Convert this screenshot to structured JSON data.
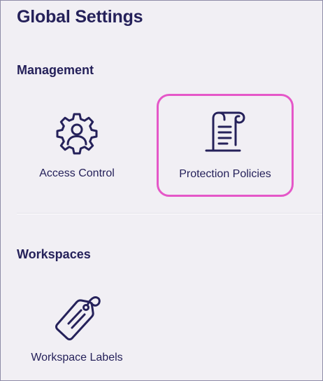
{
  "header": {
    "title": "Global Settings"
  },
  "sections": {
    "management": {
      "title": "Management",
      "items": [
        {
          "label": "Access Control",
          "icon": "user-gear-icon"
        },
        {
          "label": "Protection Policies",
          "icon": "scroll-document-icon",
          "highlighted": true
        }
      ]
    },
    "workspaces": {
      "title": "Workspaces",
      "items": [
        {
          "label": "Workspace Labels",
          "icon": "tag-icon"
        }
      ]
    }
  },
  "colors": {
    "background": "#f1eff4",
    "text": "#25215a",
    "highlight": "#e557c8",
    "border": "#8f8ca8"
  }
}
